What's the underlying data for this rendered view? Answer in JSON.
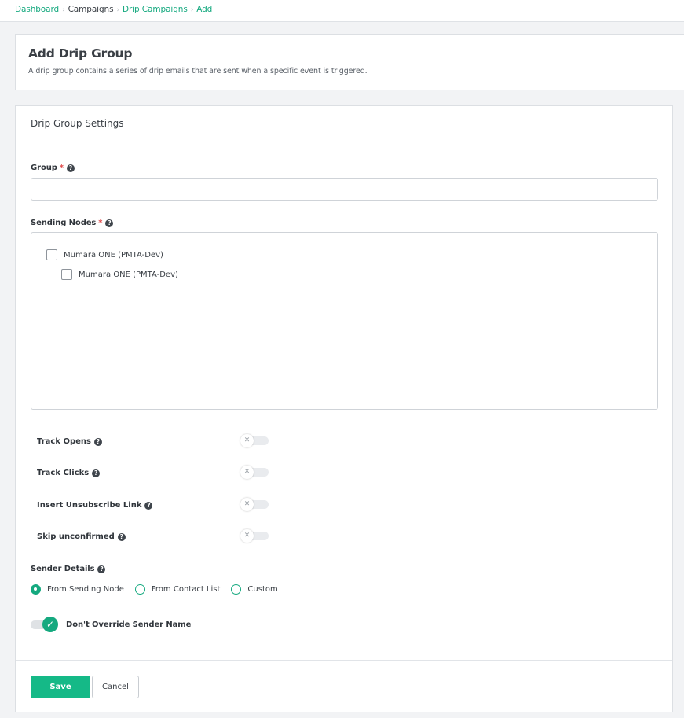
{
  "breadcrumb": {
    "items": [
      {
        "label": "Dashboard"
      },
      {
        "label": "Campaigns"
      },
      {
        "label": "Drip Campaigns"
      },
      {
        "label": "Add"
      }
    ],
    "separator": "›"
  },
  "header": {
    "title": "Add Drip Group",
    "description": "A drip group contains a series of drip emails that are sent when a specific event is triggered."
  },
  "settings": {
    "title": "Drip Group Settings",
    "group": {
      "label": "Group",
      "required_mark": "*",
      "value": "",
      "placeholder": ""
    },
    "sending_nodes": {
      "label": "Sending Nodes",
      "required_mark": "*",
      "items": [
        {
          "label": "Mumara ONE (PMTA-Dev)",
          "checked": false
        },
        {
          "label": "Mumara ONE (PMTA-Dev)",
          "checked": false
        }
      ]
    },
    "toggles": [
      {
        "label": "Track Opens",
        "enabled": false
      },
      {
        "label": "Track Clicks",
        "enabled": false
      },
      {
        "label": "Insert Unsubscribe Link",
        "enabled": false
      },
      {
        "label": "Skip unconfirmed",
        "enabled": false
      }
    ],
    "sender_details": {
      "label": "Sender Details",
      "options": [
        {
          "label": "From Sending Node",
          "selected": true
        },
        {
          "label": "From Contact List",
          "selected": false
        },
        {
          "label": "Custom",
          "selected": false
        }
      ]
    },
    "dont_override": {
      "label": "Don't Override Sender Name",
      "enabled": true
    }
  },
  "actions": {
    "save_label": "Save",
    "cancel_label": "Cancel"
  },
  "colors": {
    "accent": "#15a97f",
    "save_button": "#15b987",
    "required": "#e04b4b"
  },
  "icons": {
    "help": "question-circle-icon",
    "toggle_off": "x-icon",
    "toggle_on": "check-icon"
  }
}
